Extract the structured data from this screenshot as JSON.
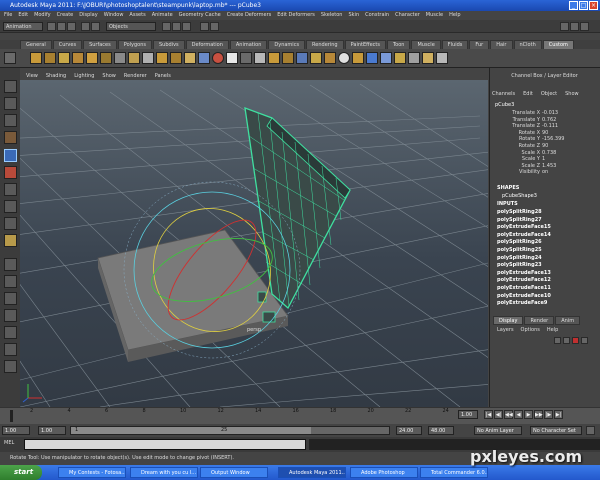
{
  "window": {
    "title": "Autodesk Maya 2011: F:\\JOBURI\\photoshoptalent\\steampunk\\laptop.mb*  ---  pCube3"
  },
  "menubar": [
    "File",
    "Edit",
    "Modify",
    "Create",
    "Display",
    "Window",
    "Assets",
    "Animate",
    "Geometry Cache",
    "Create Deformers",
    "Edit Deformers",
    "Skeleton",
    "Skin",
    "Constrain",
    "Character",
    "Muscle",
    "Help"
  ],
  "statusline": {
    "mode": "Animation",
    "selection_field": "Objects"
  },
  "shelf_tabs": [
    "General",
    "Curves",
    "Surfaces",
    "Polygons",
    "Subdivs",
    "Deformation",
    "Animation",
    "Dynamics",
    "Rendering",
    "PaintEffects",
    "Toon",
    "Muscle",
    "Fluids",
    "Fur",
    "Hair",
    "nCloth",
    "Custom"
  ],
  "shelf_active": "Custom",
  "viewport": {
    "menu": [
      "View",
      "Shading",
      "Lighting",
      "Show",
      "Renderer",
      "Panels"
    ],
    "camera": "persp"
  },
  "channel_box": {
    "title": "Channel Box / Layer Editor",
    "menu": [
      "Channels",
      "Edit",
      "Object",
      "Show"
    ],
    "object": "pCube3",
    "attributes": [
      {
        "name": "Translate X",
        "value": "-0.013"
      },
      {
        "name": "Translate Y",
        "value": "0.762"
      },
      {
        "name": "Translate Z",
        "value": "-0.111"
      },
      {
        "name": "Rotate X",
        "value": "90"
      },
      {
        "name": "Rotate Y",
        "value": "-156.399"
      },
      {
        "name": "Rotate Z",
        "value": "90"
      },
      {
        "name": "Scale X",
        "value": "0.738"
      },
      {
        "name": "Scale Y",
        "value": "1"
      },
      {
        "name": "Scale Z",
        "value": "1.453"
      },
      {
        "name": "Visibility",
        "value": "on"
      }
    ],
    "shapes_label": "SHAPES",
    "shape": "pCubeShape3",
    "inputs_label": "INPUTS",
    "inputs": [
      "polySplitRing28",
      "polySplitRing27",
      "polyExtrudeFace15",
      "polyExtrudeFace14",
      "polySplitRing26",
      "polySplitRing25",
      "polySplitRing24",
      "polySplitRing23",
      "polyExtrudeFace13",
      "polyExtrudeFace12",
      "polyExtrudeFace11",
      "polyExtrudeFace10",
      "polyExtrudeFace9"
    ]
  },
  "layer_editor": {
    "tabs": [
      "Display",
      "Render",
      "Anim"
    ],
    "menu": [
      "Layers",
      "Options",
      "Help"
    ]
  },
  "time_slider": {
    "ticks": [
      "2",
      "4",
      "6",
      "8",
      "10",
      "12",
      "14",
      "16",
      "18",
      "20",
      "22",
      "24"
    ],
    "current": "1.00"
  },
  "range": {
    "start": "1.00",
    "inner_start": "1.00",
    "inner_value": "1",
    "inner_end": "25",
    "end": "24.00",
    "total": "48.00",
    "anim_layer": "No Anim Layer",
    "char_set": "No Character Set"
  },
  "mel": {
    "label": "MEL"
  },
  "helpline": "Rotate Tool: Use manipulator to rotate object(s). Use edit mode to change pivot (INSERT).",
  "taskbar": {
    "start": "start",
    "tasks": [
      {
        "label": "My Contests - Fotosa..."
      },
      {
        "label": "Dream with you cu l..."
      },
      {
        "label": "Output Window"
      },
      {
        "label": "Autodesk Maya 2011..."
      },
      {
        "label": "Adobe Photoshop"
      },
      {
        "label": "Total Commander 6.0..."
      }
    ]
  },
  "watermark": "pxleyes.com"
}
